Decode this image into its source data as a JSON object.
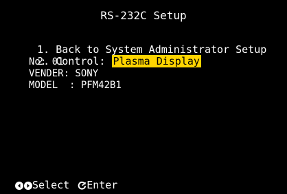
{
  "screen": {
    "title": "RS-232C Setup",
    "menu": [
      {
        "label": "1. Back to System Administrator Setup"
      },
      {
        "label": "2. Control: ",
        "value": "Plasma Display"
      }
    ],
    "details": {
      "no": "No: 01",
      "vender": "VENDER: SONY",
      "model": "MODEL  : PFM42B1"
    },
    "footer": {
      "select_label": "Select",
      "enter_label": "Enter"
    },
    "colors": {
      "background": "#000000",
      "text": "#ffffff",
      "highlight": "#ffd400"
    },
    "icons": {
      "select": [
        "left-arrow-circle-icon",
        "right-arrow-circle-icon"
      ],
      "enter": "rotary-enter-icon"
    }
  }
}
